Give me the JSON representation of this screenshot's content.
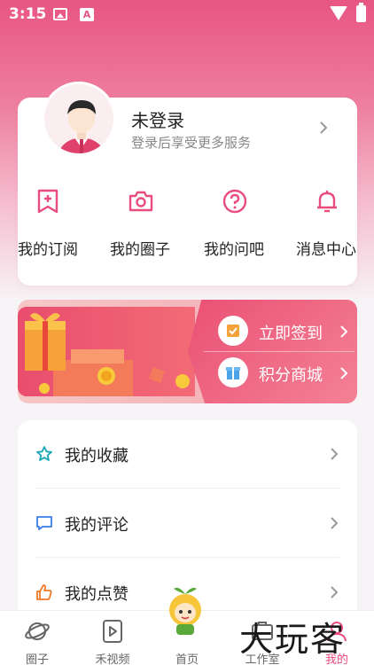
{
  "status_bar": {
    "time": "3:15",
    "icons": [
      "photo-icon",
      "a-icon",
      "wifi-icon",
      "battery-icon"
    ]
  },
  "colors": {
    "accent": "#e94d7e",
    "header_gradient_top": "#e85584",
    "banner_red": "#ea5074"
  },
  "profile": {
    "title": "未登录",
    "subtitle": "登录后享受更多服务",
    "quick_actions": [
      {
        "label": "我的订阅",
        "icon": "bookmark-add-icon"
      },
      {
        "label": "我的圈子",
        "icon": "camera-icon"
      },
      {
        "label": "我的问吧",
        "icon": "question-icon"
      },
      {
        "label": "消息中心",
        "icon": "bell-icon"
      }
    ]
  },
  "banner": {
    "actions": [
      {
        "label": "立即签到",
        "icon": "checkin-icon"
      },
      {
        "label": "积分商城",
        "icon": "gift-icon"
      }
    ]
  },
  "menu": {
    "items": [
      {
        "label": "我的收藏",
        "icon": "star-icon"
      },
      {
        "label": "我的评论",
        "icon": "comment-icon"
      },
      {
        "label": "我的点赞",
        "icon": "thumbs-up-icon"
      }
    ]
  },
  "bottom_nav": {
    "items": [
      {
        "label": "圈子",
        "icon": "planet-icon"
      },
      {
        "label": "禾视频",
        "icon": "video-icon"
      },
      {
        "label": "首页",
        "icon": "home-mascot-icon"
      },
      {
        "label": "工作室",
        "icon": "studio-icon"
      },
      {
        "label": "我的",
        "icon": "profile-icon",
        "active": true
      }
    ]
  },
  "watermark": {
    "text": "大玩客"
  }
}
